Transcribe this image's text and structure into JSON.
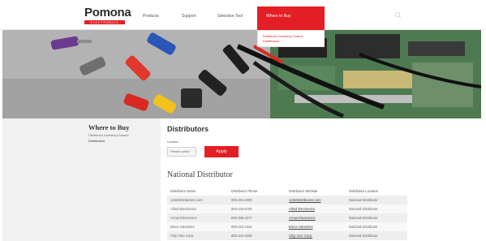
{
  "header": {
    "logo": {
      "name": "Pomona",
      "tagline": "ELECTRONICS"
    },
    "nav": [
      {
        "label": "Products"
      },
      {
        "label": "Support"
      },
      {
        "label": "Selection Tool"
      },
      {
        "label": "Where to Buy"
      }
    ],
    "dropdown": [
      {
        "label": "Distributor Inventory Search"
      },
      {
        "label": "Distributors"
      }
    ],
    "search_icon": "search-icon"
  },
  "hero": {
    "image": "test-leads-and-banana-plugs-photo"
  },
  "sidebar": {
    "title": "Where to Buy",
    "links": [
      {
        "label": "Distributor Inventory Search"
      },
      {
        "label": "Distributors"
      }
    ]
  },
  "main": {
    "title": "Distributors",
    "location_label": "Location",
    "location_value": "Please select",
    "apply_label": "Apply",
    "section_title": "National Distributor",
    "table": {
      "columns": [
        "Distributor Name",
        "Distributor Phone",
        "Distributor Website",
        "Distributor Location"
      ],
      "rows": [
        [
          "123eDistributors.com",
          "800.353.4000",
          "123eDistributors.com",
          "National Distributor"
        ],
        [
          "Allied Electronics",
          "800.433.5700",
          "Allied Electronics",
          "National Distributor"
        ],
        [
          "Arrow Electronics",
          "800.388.2277",
          "Arrow Electronics",
          "National Distributor"
        ],
        [
          "Bisco Industries",
          "800.323.1232",
          "Bisco Industries",
          "National Distributor"
        ],
        [
          "Chip One Corp.",
          "800.344.4539",
          "Chip One Corp.",
          "National Distributor"
        ]
      ]
    }
  },
  "colors": {
    "brand_red": "#e31e24",
    "sidebar_bg": "#f1f1f1"
  }
}
